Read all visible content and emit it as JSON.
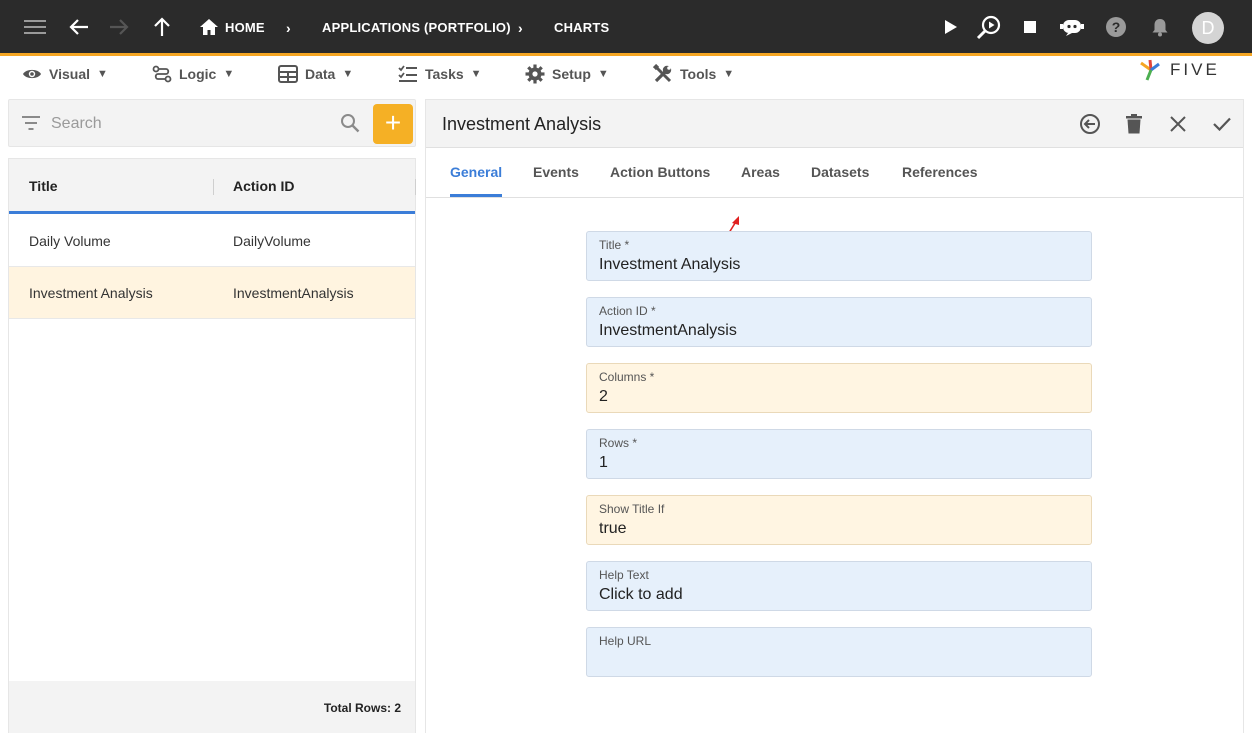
{
  "topbar": {
    "breadcrumbs": [
      "HOME",
      "APPLICATIONS (PORTFOLIO)",
      "CHARTS"
    ],
    "avatar_initial": "D",
    "accent_color": "#f5a623",
    "icons": [
      "menu-icon",
      "back-arrow-icon",
      "forward-arrow-icon",
      "up-arrow-icon",
      "home-icon",
      "play-icon",
      "search-run-icon",
      "stop-icon",
      "chat-bot-icon",
      "help-icon",
      "bell-icon"
    ]
  },
  "menubar": {
    "items": [
      {
        "label": "Visual",
        "icon": "eye-icon"
      },
      {
        "label": "Logic",
        "icon": "flow-icon"
      },
      {
        "label": "Data",
        "icon": "table-icon"
      },
      {
        "label": "Tasks",
        "icon": "checklist-icon"
      },
      {
        "label": "Setup",
        "icon": "gear-icon"
      },
      {
        "label": "Tools",
        "icon": "wrench-icon"
      }
    ],
    "logo_text": "FIVE"
  },
  "search": {
    "placeholder": "Search",
    "add_label": "+"
  },
  "list": {
    "columns": [
      "Title",
      "Action ID"
    ],
    "rows": [
      {
        "title": "Daily Volume",
        "action_id": "DailyVolume",
        "selected": false
      },
      {
        "title": "Investment Analysis",
        "action_id": "InvestmentAnalysis",
        "selected": true
      }
    ],
    "total_rows": "Total Rows: 2"
  },
  "form": {
    "title": "Investment Analysis",
    "tabs": [
      {
        "label": "General",
        "active": true
      },
      {
        "label": "Events",
        "active": false
      },
      {
        "label": "Action Buttons",
        "active": false
      },
      {
        "label": "Areas",
        "active": false
      },
      {
        "label": "Datasets",
        "active": false
      },
      {
        "label": "References",
        "active": false
      }
    ],
    "fields": [
      {
        "label": "Title *",
        "value": "Investment Analysis",
        "style": "normal"
      },
      {
        "label": "Action ID *",
        "value": "InvestmentAnalysis",
        "style": "normal"
      },
      {
        "label": "Columns *",
        "value": "2",
        "style": "warn"
      },
      {
        "label": "Rows *",
        "value": "1",
        "style": "normal"
      },
      {
        "label": "Show Title If",
        "value": "true",
        "style": "warn"
      },
      {
        "label": "Help Text",
        "value": "Click to add",
        "style": "normal"
      },
      {
        "label": "Help URL",
        "value": "",
        "style": "normal"
      }
    ],
    "colors": {
      "tab_active": "#3b7dd8",
      "field_bg": "#e6f0fb",
      "field_warn_bg": "#fff5e2",
      "add_button": "#f5b025",
      "annotation_arrow": "#e02020"
    }
  }
}
